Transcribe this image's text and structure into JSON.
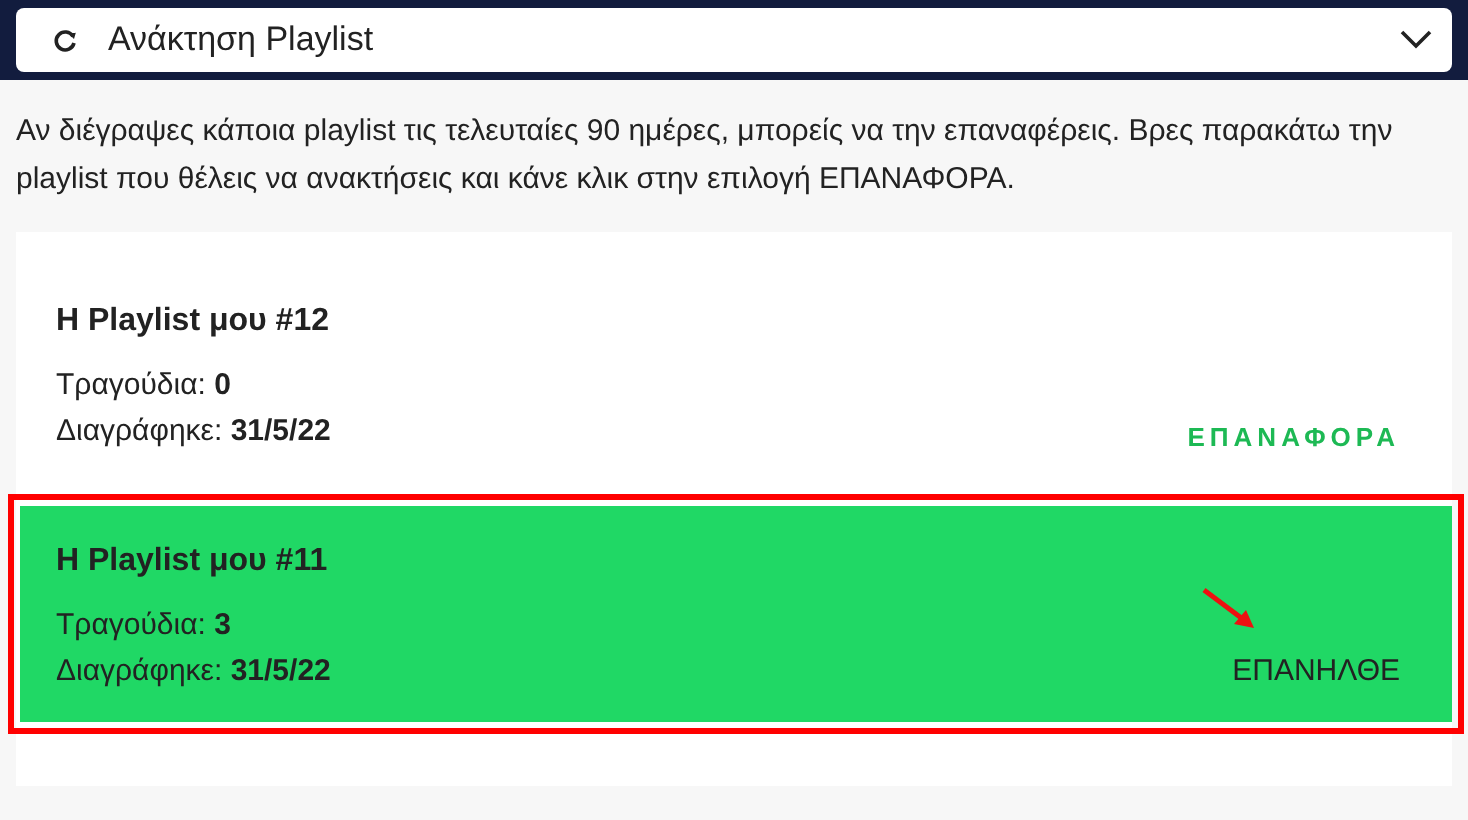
{
  "dropdown": {
    "label": "Ανάκτηση Playlist",
    "expanded": false
  },
  "intro": "Αν διέγραψες κάποια playlist τις τελευταίες 90 ημέρες, μπορείς να την επαναφέρεις. Βρες παρακάτω την playlist που θέλεις να ανακτήσεις και κάνε κλικ στην επιλογή ΕΠΑΝΑΦΟΡΑ.",
  "playlists": [
    {
      "title": "Η Playlist μου #12",
      "songs_label": "Τραγούδια: ",
      "songs": "0",
      "deleted_label": "Διαγράφηκε: ",
      "deleted": "31/5/22",
      "action": "ΕΠΑΝΑΦΟΡΑ",
      "restored": false,
      "highlighted": false
    },
    {
      "title": "Η Playlist μου #11",
      "songs_label": "Τραγούδια: ",
      "songs": "3",
      "deleted_label": "Διαγράφηκε: ",
      "deleted": "31/5/22",
      "action": "ΕΠΑΝΗΛΘΕ",
      "restored": true,
      "highlighted": true
    }
  ]
}
